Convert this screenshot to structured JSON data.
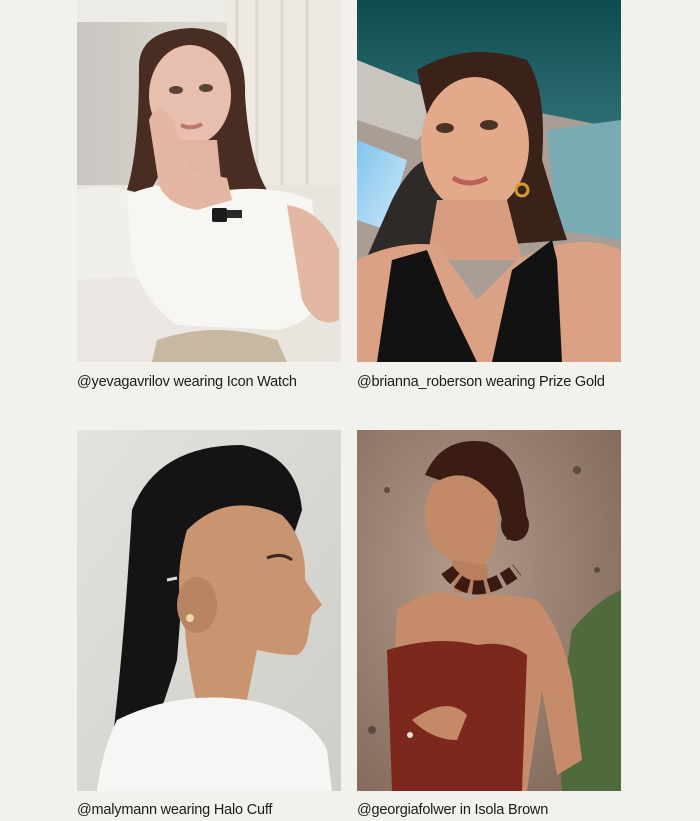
{
  "gallery": {
    "items": [
      {
        "caption": "@yevagavrilov wearing Icon Watch",
        "handle": "@yevagavrilov",
        "product": "Icon Watch"
      },
      {
        "caption": "@brianna_roberson wearing Prize Gold",
        "handle": "@brianna_roberson",
        "product": "Prize Gold"
      },
      {
        "caption": "@malymann wearing Halo Cuff",
        "handle": "@malymann",
        "product": "Halo Cuff"
      },
      {
        "caption": "@georgiafolwer in Isola Brown",
        "handle": "@georgiafolwer",
        "product": "Isola Brown"
      }
    ]
  },
  "colors": {
    "page_background": "#f2f1ed",
    "caption_text": "#1b1b1b"
  }
}
